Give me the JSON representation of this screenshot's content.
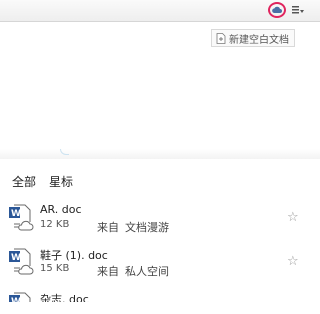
{
  "toolbar": {
    "new_doc_label": "新建空白文档"
  },
  "tabs": [
    {
      "label": "全部"
    },
    {
      "label": "星标"
    }
  ],
  "files": [
    {
      "name": "AR. doc",
      "size": "12 KB",
      "source_prefix": "来自",
      "source": "文档漫游"
    },
    {
      "name": "鞋子 (1). doc",
      "size": "15 KB",
      "source_prefix": "来自",
      "source": "私人空间"
    },
    {
      "name": "杂志. doc"
    }
  ],
  "icons": {
    "cloud": "cloud-icon",
    "menu": "dropdown-menu-icon",
    "doc": "word-doc-icon",
    "star": "star-icon"
  },
  "colors": {
    "accent": "#e0245e",
    "doc_blue": "#2b5797"
  }
}
